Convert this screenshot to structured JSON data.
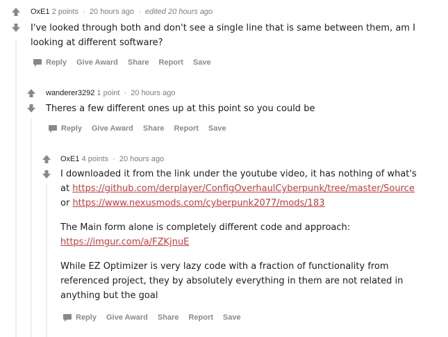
{
  "comments": [
    {
      "author": "OxE1",
      "points": "2 points",
      "time": "20 hours ago",
      "edited": "edited 20 hours ago",
      "body": [
        "I've looked through both and don't see a single line that is same between them, am I",
        "looking at different software?"
      ]
    },
    {
      "author": "wanderer3292",
      "points": "1 point",
      "time": "20 hours ago",
      "body": [
        "Theres a few different ones up at this point so you could be"
      ]
    },
    {
      "author": "OxE1",
      "points": "4 points",
      "time": "20 hours ago",
      "body_line1": "I downloaded it from the link under the youtube video, it has nothing of what's",
      "at_prefix": "at ",
      "link_github": "https://github.com/derplayer/ConfigOverhaulCyberpunk/tree/master/Source",
      "or_prefix": "or ",
      "link_nexus": "https://www.nexusmods.com/cyberpunk2077/mods/183",
      "para2_line1": "The Main form alone is completely different code and approach:",
      "link_imgur": "https://imgur.com/a/FZKjnuE",
      "para3": [
        "While EZ Optimizer is very lazy code with a fraction of functionality from",
        "referenced project, they by absolutely everything in them are not related in",
        "anything but the goal"
      ]
    }
  ],
  "actions": {
    "reply": "Reply",
    "give_award": "Give Award",
    "share": "Share",
    "report": "Report",
    "save": "Save"
  },
  "separator": "·",
  "colors": {
    "link": "#c23b3b",
    "meta": "#7c7c7c",
    "action": "#878a8c",
    "thread_line": "#edeff1"
  },
  "icons": {
    "upvote": "upvote-arrow-icon",
    "downvote": "downvote-arrow-icon",
    "reply": "speech-bubble-icon"
  }
}
